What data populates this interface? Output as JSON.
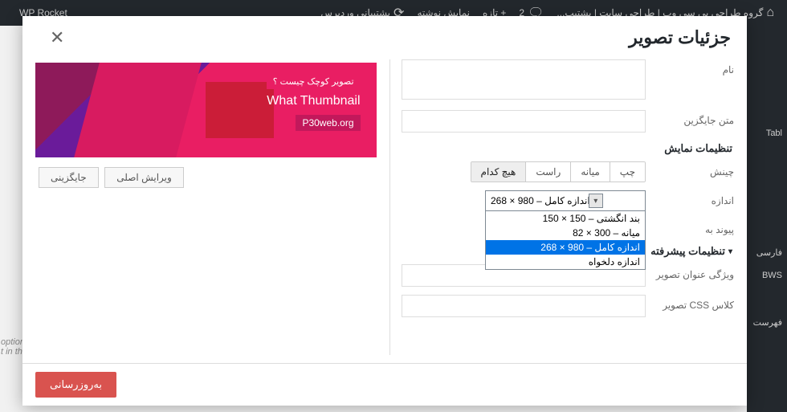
{
  "adminbar": {
    "site": "گروه طراحی پی سی وب | طراحی سایت | پشتیپ...",
    "comments": "2",
    "new": "+ تازه",
    "view_post": "نمایش نوشته",
    "wp_support": "پشتیبانی وردپرس",
    "wp_rocket": "WP Rocket"
  },
  "bg": {
    "tabl": "Tabl",
    "farsi": "فارسی",
    "bws": "BWS",
    "list": "فهرست",
    "opt": "option",
    "tin": "t in th"
  },
  "modal": {
    "title": "جزئیات تصویر",
    "caption_label": "نام",
    "caption_value": "",
    "alt_label": "متن جایگزین",
    "alt_value": "",
    "display_section": "تنظیمات نمایش",
    "align_label": "چینش",
    "align": {
      "left": "چپ",
      "center": "میانه",
      "right": "راست",
      "none": "هیچ کدام"
    },
    "size_label": "اندازه",
    "size_selected": "اندازه کامل – 980 × 268",
    "size_options": [
      "بند انگشتی – 150 × 150",
      "میانه – 300 × 82",
      "اندازه کامل – 980 × 268",
      "اندازه دلخواه"
    ],
    "link_label": "پیوند به",
    "advanced_section": "تنظیمات پیشرفته",
    "title_attr_label": "ویژگی عنوان تصویر",
    "title_attr_value": "",
    "css_class_label": "کلاس CSS تصویر",
    "css_class_value": "",
    "edit_original": "ویرایش اصلی",
    "replace": "جایگزینی",
    "update": "به‌روزرسانی",
    "thumb": {
      "line1": "تصویر کوچک چیست ؟",
      "line2": "What Thumbnail",
      "line3": "P30web.org"
    }
  }
}
